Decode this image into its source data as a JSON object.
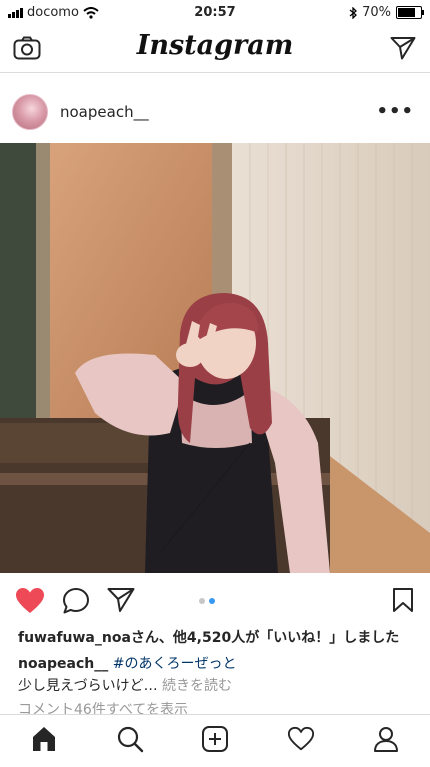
{
  "status_bar": {
    "carrier": "docomo",
    "time": "20:57",
    "battery": "70%",
    "battery_level": 0.7
  },
  "header": {
    "title": "Instagram",
    "icons": [
      "camera-icon",
      "direct-message-icon"
    ]
  },
  "post": {
    "username": "noapeach__",
    "more_label": "•••",
    "carousel_dots": 2,
    "carousel_active": 1,
    "likes_user": "fuwafuwa_noa",
    "likes_text": "さん、他4,520人が「いいね！」しました",
    "caption_user": "noapeach__",
    "caption_tag": "#のあくろーぜっと",
    "caption_text": "少し見えづらいけど…",
    "caption_more": "続きを読む",
    "comments_text": "コメント46件すべてを表示",
    "like_color": "#ed4956",
    "link_color": "#003569"
  },
  "tabbar": {
    "icons": [
      "home-icon",
      "search-icon",
      "add-post-icon",
      "activity-heart-icon",
      "profile-icon"
    ]
  }
}
